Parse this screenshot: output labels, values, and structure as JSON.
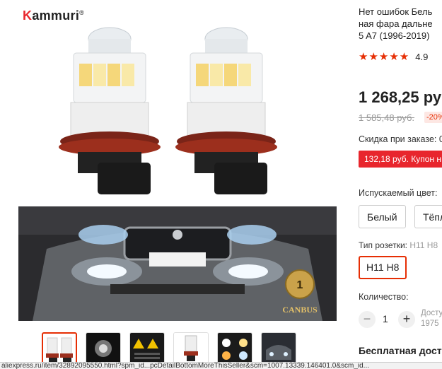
{
  "brand": {
    "name": "Kammuri",
    "first_letter": "K",
    "rest": "ammuri",
    "mark": "®"
  },
  "product": {
    "title_lines": [
      "Нет ошибок Бель",
      "ная фара дальне",
      "5 A7 (1996-2019)"
    ],
    "rating": {
      "stars": "★★★★★",
      "value": "4.9"
    },
    "price": "1 268,25 ру",
    "old_price": "1 585,48 руб.",
    "discount": "-20%",
    "order_discount_label": "Скидка при заказе: 0",
    "coupon_text": "132,18 руб. Купон н",
    "color_label": "Испускаемый цвет:",
    "color_options": [
      "Белый",
      "Тёпл"
    ],
    "socket_label": "Тип розетки:",
    "socket_value": "H11 H8",
    "socket_option": "H11 H8",
    "quantity_label": "Количество:",
    "quantity": "1",
    "qty_minus": "−",
    "qty_plus": "+",
    "available_lines": [
      "Досту",
      "1975"
    ],
    "shipping": "Бесплатная дост"
  },
  "gallery": {
    "badge_text": "CANBUS",
    "warranty_text": "1",
    "thumbnail_count": 6,
    "active_thumbnail": 1
  },
  "statusbar": {
    "url": "aliexpress.ru/item/32892095550.html?spm_id...pcDetailBottomMoreThisSeller&scm=1007.13339.146401.0&scm_id..."
  },
  "colors": {
    "accent": "#e62e04",
    "coupon_bg": "#e8262d",
    "star": "#e62e04"
  }
}
